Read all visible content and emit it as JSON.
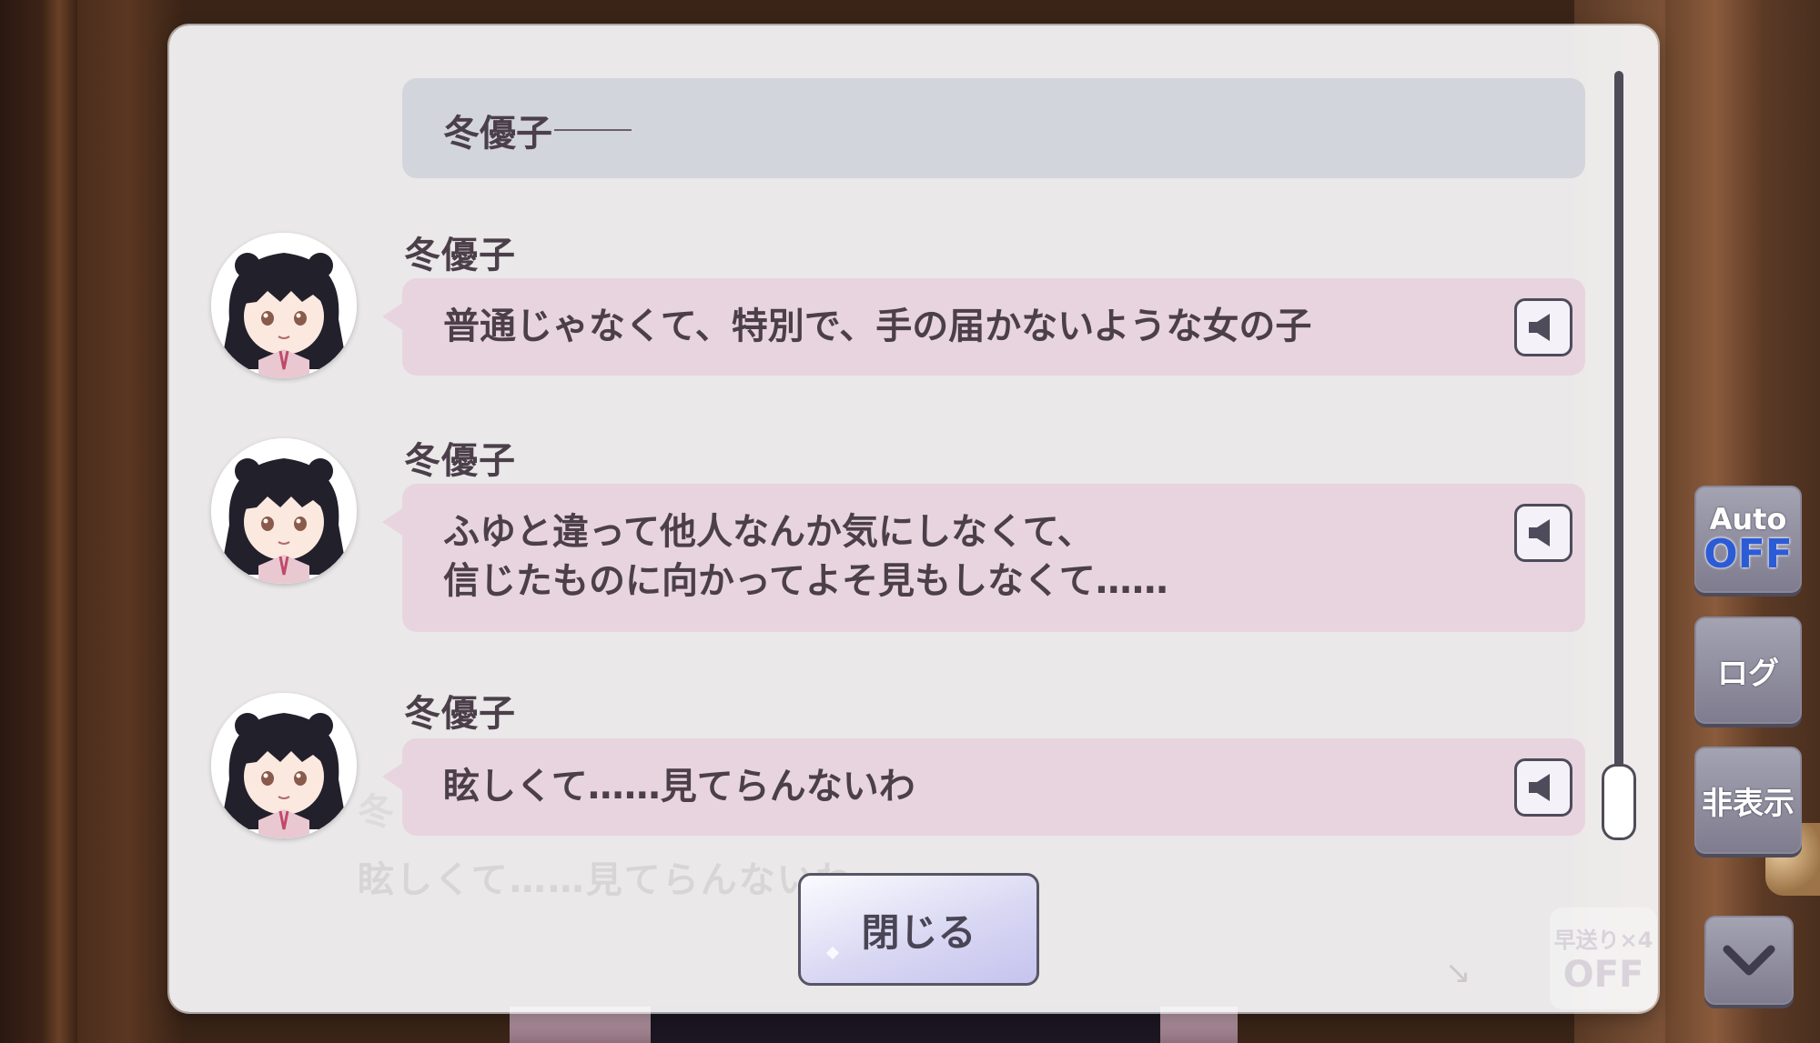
{
  "narration": {
    "speaker": "冬優子"
  },
  "entries": [
    {
      "speaker": "冬優子",
      "text": "普通じゃなくて、特別で、手の届かないような女の子"
    },
    {
      "speaker": "冬優子",
      "text": "ふゆと違って他人なんか気にしなくて、\n信じたものに向かってよそ見もしなくて……"
    },
    {
      "speaker": "冬優子",
      "text": "眩しくて……見てらんないわ"
    }
  ],
  "background_text": {
    "line": "眩しくて……見てらんないわ",
    "name": "冬"
  },
  "close_button": {
    "label": "閉じる"
  },
  "controls": {
    "auto_top": "Auto",
    "auto_state": "OFF",
    "log_label": "ログ",
    "hide_label": "非表示",
    "fast_forward_top": "早送り×4",
    "fast_forward_state": "OFF"
  },
  "icons": {
    "voice": "speaker-icon",
    "down": "chevron-down-icon",
    "hint": "arrow-down-right-icon"
  },
  "colors": {
    "bubble": "#e8d4df",
    "narration": "#d3d5dd",
    "auto_off": "#2c5bd6"
  }
}
